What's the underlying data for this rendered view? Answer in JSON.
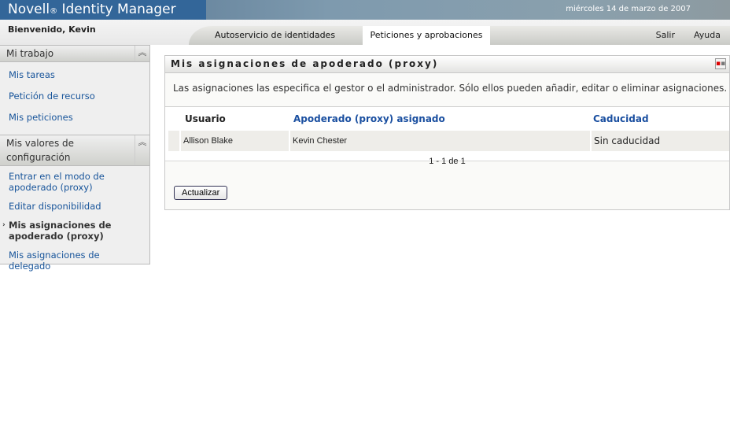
{
  "header": {
    "brand": "Novell",
    "brand_mark": "®",
    "product": "Identity Manager",
    "date": "miércoles 14 de marzo de 2007"
  },
  "nav": {
    "welcome": "Bienvenido, Kevin",
    "tabs": [
      {
        "label": "Autoservicio de identidades"
      },
      {
        "label": "Peticiones y aprobaciones",
        "active": true
      }
    ],
    "logout": "Salir",
    "help": "Ayuda"
  },
  "sidebar": {
    "sections": [
      {
        "title": "Mi trabajo",
        "items": [
          "Mis tareas",
          "Petición de recurso",
          "Mis peticiones"
        ]
      },
      {
        "title": "Mis valores de configuración",
        "items": [
          "Entrar en el modo de apoderado (proxy)",
          "Editar disponibilidad",
          "Mis asignaciones de apoderado (proxy)",
          "Mis asignaciones de delegado"
        ],
        "active_index": 2
      }
    ]
  },
  "panel": {
    "title": "Mis asignaciones de apoderado (proxy)",
    "description": "Las asignaciones las especifica el gestor o el administrador. Sólo ellos pueden añadir, editar o eliminar asignaciones.",
    "columns": [
      "Usuario",
      "Apoderado (proxy) asignado",
      "Caducidad"
    ],
    "rows": [
      {
        "user": "Allison Blake",
        "proxy": "Kevin Chester",
        "expiry": "Sin caducidad"
      }
    ],
    "pager": "1 - 1 de 1",
    "refresh_label": "Actualizar"
  }
}
